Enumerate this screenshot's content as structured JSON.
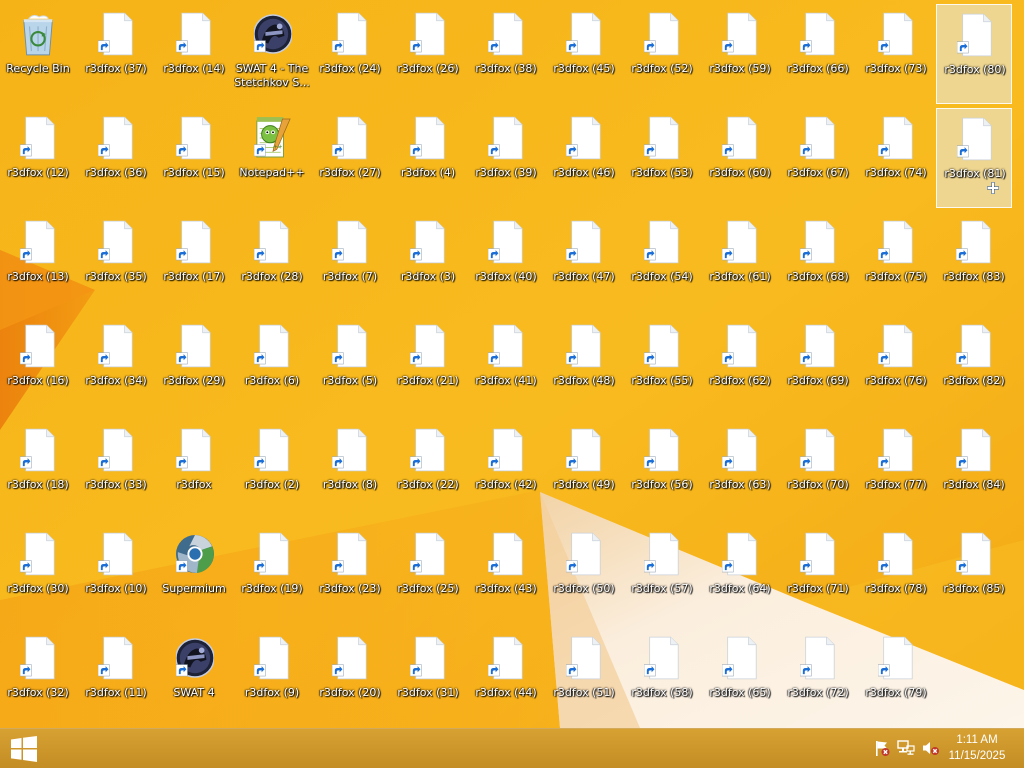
{
  "desktop": {
    "icons": [
      {
        "label": "Recycle Bin",
        "type": "recycle",
        "col": 0,
        "row": 0
      },
      {
        "label": "r3dfox (37)",
        "type": "file",
        "col": 1,
        "row": 0
      },
      {
        "label": "r3dfox (14)",
        "type": "file",
        "col": 2,
        "row": 0
      },
      {
        "label": "SWAT 4 - The Stetchkov S...",
        "type": "swat",
        "col": 3,
        "row": 0
      },
      {
        "label": "r3dfox (24)",
        "type": "file",
        "col": 4,
        "row": 0
      },
      {
        "label": "r3dfox (26)",
        "type": "file",
        "col": 5,
        "row": 0
      },
      {
        "label": "r3dfox (38)",
        "type": "file",
        "col": 6,
        "row": 0
      },
      {
        "label": "r3dfox (45)",
        "type": "file",
        "col": 7,
        "row": 0
      },
      {
        "label": "r3dfox (52)",
        "type": "file",
        "col": 8,
        "row": 0
      },
      {
        "label": "r3dfox (59)",
        "type": "file",
        "col": 9,
        "row": 0
      },
      {
        "label": "r3dfox (66)",
        "type": "file",
        "col": 10,
        "row": 0
      },
      {
        "label": "r3dfox (73)",
        "type": "file",
        "col": 11,
        "row": 0
      },
      {
        "label": "r3dfox (80)",
        "type": "file",
        "col": 12,
        "row": 0,
        "selected": true
      },
      {
        "label": "r3dfox (12)",
        "type": "file",
        "col": 0,
        "row": 1
      },
      {
        "label": "r3dfox (36)",
        "type": "file",
        "col": 1,
        "row": 1
      },
      {
        "label": "r3dfox (15)",
        "type": "file",
        "col": 2,
        "row": 1
      },
      {
        "label": "Notepad++",
        "type": "notepad",
        "col": 3,
        "row": 1
      },
      {
        "label": "r3dfox (27)",
        "type": "file",
        "col": 4,
        "row": 1
      },
      {
        "label": "r3dfox (4)",
        "type": "file",
        "col": 5,
        "row": 1
      },
      {
        "label": "r3dfox (39)",
        "type": "file",
        "col": 6,
        "row": 1
      },
      {
        "label": "r3dfox (46)",
        "type": "file",
        "col": 7,
        "row": 1
      },
      {
        "label": "r3dfox (53)",
        "type": "file",
        "col": 8,
        "row": 1
      },
      {
        "label": "r3dfox (60)",
        "type": "file",
        "col": 9,
        "row": 1
      },
      {
        "label": "r3dfox (67)",
        "type": "file",
        "col": 10,
        "row": 1
      },
      {
        "label": "r3dfox (74)",
        "type": "file",
        "col": 11,
        "row": 1
      },
      {
        "label": "r3dfox (81)",
        "type": "file",
        "col": 12,
        "row": 1,
        "selected": true
      },
      {
        "label": "r3dfox (13)",
        "type": "file",
        "col": 0,
        "row": 2
      },
      {
        "label": "r3dfox (35)",
        "type": "file",
        "col": 1,
        "row": 2
      },
      {
        "label": "r3dfox (17)",
        "type": "file",
        "col": 2,
        "row": 2
      },
      {
        "label": "r3dfox (28)",
        "type": "file",
        "col": 3,
        "row": 2
      },
      {
        "label": "r3dfox (7)",
        "type": "file",
        "col": 4,
        "row": 2
      },
      {
        "label": "r3dfox (3)",
        "type": "file",
        "col": 5,
        "row": 2
      },
      {
        "label": "r3dfox (40)",
        "type": "file",
        "col": 6,
        "row": 2
      },
      {
        "label": "r3dfox (47)",
        "type": "file",
        "col": 7,
        "row": 2
      },
      {
        "label": "r3dfox (54)",
        "type": "file",
        "col": 8,
        "row": 2
      },
      {
        "label": "r3dfox (61)",
        "type": "file",
        "col": 9,
        "row": 2
      },
      {
        "label": "r3dfox (68)",
        "type": "file",
        "col": 10,
        "row": 2
      },
      {
        "label": "r3dfox (75)",
        "type": "file",
        "col": 11,
        "row": 2
      },
      {
        "label": "r3dfox (83)",
        "type": "file",
        "col": 12,
        "row": 2
      },
      {
        "label": "r3dfox (16)",
        "type": "file",
        "col": 0,
        "row": 3
      },
      {
        "label": "r3dfox (34)",
        "type": "file",
        "col": 1,
        "row": 3
      },
      {
        "label": "r3dfox (29)",
        "type": "file",
        "col": 2,
        "row": 3
      },
      {
        "label": "r3dfox (6)",
        "type": "file",
        "col": 3,
        "row": 3
      },
      {
        "label": "r3dfox (5)",
        "type": "file",
        "col": 4,
        "row": 3
      },
      {
        "label": "r3dfox (21)",
        "type": "file",
        "col": 5,
        "row": 3
      },
      {
        "label": "r3dfox (41)",
        "type": "file",
        "col": 6,
        "row": 3
      },
      {
        "label": "r3dfox (48)",
        "type": "file",
        "col": 7,
        "row": 3
      },
      {
        "label": "r3dfox (55)",
        "type": "file",
        "col": 8,
        "row": 3
      },
      {
        "label": "r3dfox (62)",
        "type": "file",
        "col": 9,
        "row": 3
      },
      {
        "label": "r3dfox (69)",
        "type": "file",
        "col": 10,
        "row": 3
      },
      {
        "label": "r3dfox (76)",
        "type": "file",
        "col": 11,
        "row": 3
      },
      {
        "label": "r3dfox (82)",
        "type": "file",
        "col": 12,
        "row": 3
      },
      {
        "label": "r3dfox (18)",
        "type": "file",
        "col": 0,
        "row": 4
      },
      {
        "label": "r3dfox (33)",
        "type": "file",
        "col": 1,
        "row": 4
      },
      {
        "label": "r3dfox",
        "type": "file",
        "col": 2,
        "row": 4
      },
      {
        "label": "r3dfox (2)",
        "type": "file",
        "col": 3,
        "row": 4
      },
      {
        "label": "r3dfox (8)",
        "type": "file",
        "col": 4,
        "row": 4
      },
      {
        "label": "r3dfox (22)",
        "type": "file",
        "col": 5,
        "row": 4
      },
      {
        "label": "r3dfox (42)",
        "type": "file",
        "col": 6,
        "row": 4
      },
      {
        "label": "r3dfox (49)",
        "type": "file",
        "col": 7,
        "row": 4
      },
      {
        "label": "r3dfox (56)",
        "type": "file",
        "col": 8,
        "row": 4
      },
      {
        "label": "r3dfox (63)",
        "type": "file",
        "col": 9,
        "row": 4
      },
      {
        "label": "r3dfox (70)",
        "type": "file",
        "col": 10,
        "row": 4
      },
      {
        "label": "r3dfox (77)",
        "type": "file",
        "col": 11,
        "row": 4
      },
      {
        "label": "r3dfox (84)",
        "type": "file",
        "col": 12,
        "row": 4
      },
      {
        "label": "r3dfox (30)",
        "type": "file",
        "col": 0,
        "row": 5
      },
      {
        "label": "r3dfox (10)",
        "type": "file",
        "col": 1,
        "row": 5
      },
      {
        "label": "Supermium",
        "type": "supermium",
        "col": 2,
        "row": 5
      },
      {
        "label": "r3dfox (19)",
        "type": "file",
        "col": 3,
        "row": 5
      },
      {
        "label": "r3dfox (23)",
        "type": "file",
        "col": 4,
        "row": 5
      },
      {
        "label": "r3dfox (25)",
        "type": "file",
        "col": 5,
        "row": 5
      },
      {
        "label": "r3dfox (43)",
        "type": "file",
        "col": 6,
        "row": 5
      },
      {
        "label": "r3dfox (50)",
        "type": "file",
        "col": 7,
        "row": 5
      },
      {
        "label": "r3dfox (57)",
        "type": "file",
        "col": 8,
        "row": 5
      },
      {
        "label": "r3dfox (64)",
        "type": "file",
        "col": 9,
        "row": 5
      },
      {
        "label": "r3dfox (71)",
        "type": "file",
        "col": 10,
        "row": 5
      },
      {
        "label": "r3dfox (78)",
        "type": "file",
        "col": 11,
        "row": 5
      },
      {
        "label": "r3dfox (85)",
        "type": "file",
        "col": 12,
        "row": 5
      },
      {
        "label": "r3dfox (32)",
        "type": "file",
        "col": 0,
        "row": 6
      },
      {
        "label": "r3dfox (11)",
        "type": "file",
        "col": 1,
        "row": 6
      },
      {
        "label": "SWAT 4",
        "type": "swat",
        "col": 2,
        "row": 6
      },
      {
        "label": "r3dfox (9)",
        "type": "file",
        "col": 3,
        "row": 6
      },
      {
        "label": "r3dfox (20)",
        "type": "file",
        "col": 4,
        "row": 6
      },
      {
        "label": "r3dfox (31)",
        "type": "file",
        "col": 5,
        "row": 6
      },
      {
        "label": "r3dfox (44)",
        "type": "file",
        "col": 6,
        "row": 6
      },
      {
        "label": "r3dfox (51)",
        "type": "file",
        "col": 7,
        "row": 6
      },
      {
        "label": "r3dfox (58)",
        "type": "file",
        "col": 8,
        "row": 6
      },
      {
        "label": "r3dfox (65)",
        "type": "file",
        "col": 9,
        "row": 6
      },
      {
        "label": "r3dfox (72)",
        "type": "file",
        "col": 10,
        "row": 6
      },
      {
        "label": "r3dfox (79)",
        "type": "file",
        "col": 11,
        "row": 6
      }
    ]
  },
  "taskbar": {
    "start_icon": "windows-logo-icon",
    "tray_icons": [
      "action-center-flag-icon",
      "network-icon",
      "volume-muted-icon"
    ],
    "clock_time": "1:11 AM",
    "clock_date": "11/15/2025"
  },
  "colors": {
    "wallpaper_base": "#f7b517",
    "wallpaper_orange": "#f08c0e",
    "wallpaper_light": "#fbe8c8",
    "taskbar": "#cf972c",
    "shortcut_arrow": "#1b6ed6"
  }
}
